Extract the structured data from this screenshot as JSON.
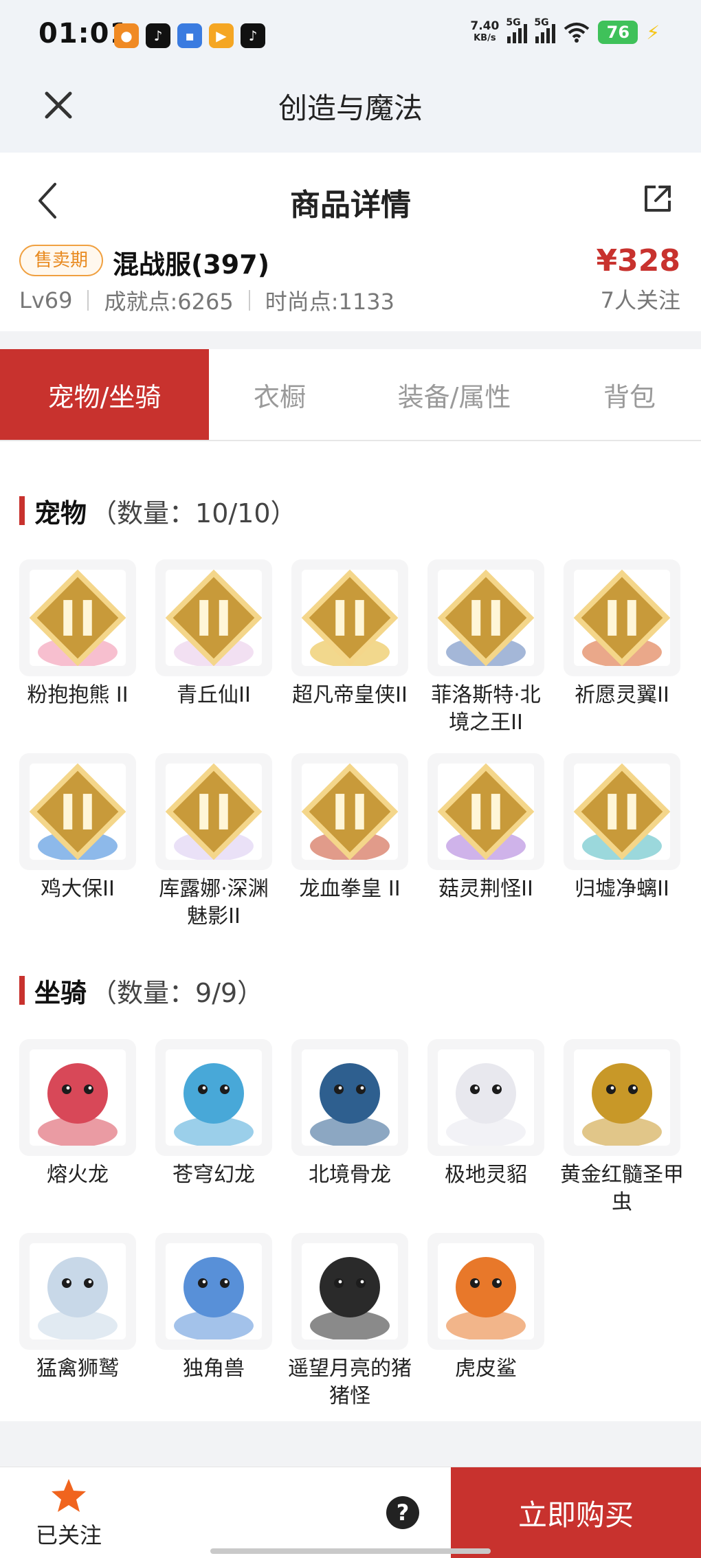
{
  "status_bar": {
    "time": "01:01",
    "net_speed_value": "7.40",
    "net_speed_unit": "KB/s",
    "signal1_label": "5G",
    "signal2_label": "5G",
    "battery": "76"
  },
  "app_bar": {
    "title": "创造与魔法"
  },
  "nav": {
    "title": "商品详情"
  },
  "product": {
    "badge": "售卖期",
    "server": "混战服(397)",
    "price": "¥328",
    "level": "Lv69",
    "achievement": "成就点:6265",
    "fashion": "时尚点:1133",
    "followers": "7人关注"
  },
  "tabs": [
    {
      "label": "宠物/坐骑",
      "active": true
    },
    {
      "label": "衣橱",
      "active": false
    },
    {
      "label": "装备/属性",
      "active": false
    },
    {
      "label": "背包",
      "active": false
    }
  ],
  "pets": {
    "title": "宠物",
    "count": "（数量：10/10）",
    "items": [
      {
        "name": "粉抱抱熊 II",
        "color": "#f08aa8",
        "tier": true
      },
      {
        "name": "青丘仙II",
        "color": "#e8c6e8",
        "tier": true
      },
      {
        "name": "超凡帝皇侠II",
        "color": "#e8b830",
        "tier": true
      },
      {
        "name": "菲洛斯特·北境之王II",
        "color": "#5a7bb8",
        "tier": true
      },
      {
        "name": "祈愿灵翼II",
        "color": "#d8602a",
        "tier": true
      },
      {
        "name": "鸡大保II",
        "color": "#2f7fd8",
        "tier": true
      },
      {
        "name": "库露娜·深渊魅影II",
        "color": "#d8c8f0",
        "tier": true
      },
      {
        "name": "龙血拳皇 II",
        "color": "#c8482a",
        "tier": true
      },
      {
        "name": "菇灵荆怪II",
        "color": "#a874d8",
        "tier": true
      },
      {
        "name": "归墟净螭II",
        "color": "#48b8c0",
        "tier": true
      }
    ]
  },
  "mounts": {
    "title": "坐骑",
    "count": "（数量：9/9）",
    "items": [
      {
        "name": "熔火龙",
        "color": "#d84858",
        "tier": false
      },
      {
        "name": "苍穹幻龙",
        "color": "#48a8d8",
        "tier": false
      },
      {
        "name": "北境骨龙",
        "color": "#2e5f8f",
        "tier": false
      },
      {
        "name": "极地灵貂",
        "color": "#e8e8ee",
        "tier": false
      },
      {
        "name": "黄金红髓圣甲虫",
        "color": "#c89828",
        "tier": false
      },
      {
        "name": "猛禽狮鹫",
        "color": "#c8d8e8",
        "tier": false
      },
      {
        "name": "独角兽",
        "color": "#5890d8",
        "tier": false
      },
      {
        "name": "遥望月亮的猪猪怪",
        "color": "#2a2a2a",
        "tier": false
      },
      {
        "name": "虎皮鲨",
        "color": "#e8782a",
        "tier": false
      }
    ]
  },
  "bottom_bar": {
    "follow_label": "已关注",
    "help": "?",
    "buy_label": "立即购买"
  }
}
